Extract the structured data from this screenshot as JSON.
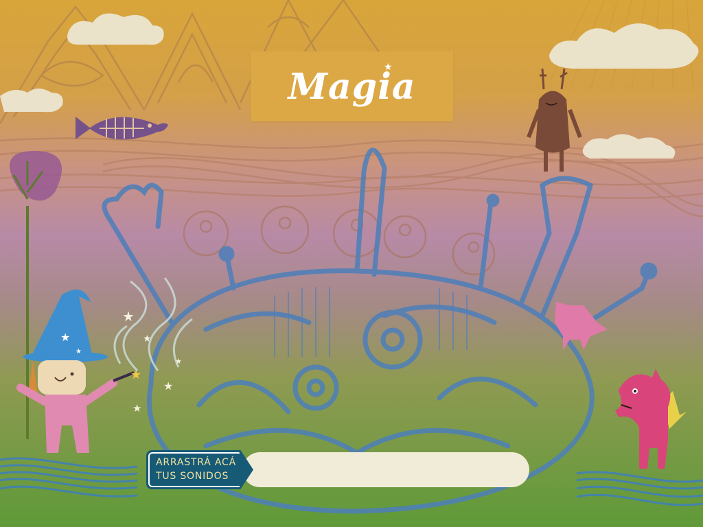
{
  "screen": {
    "title": "Magia",
    "drop_zone": {
      "label_line1": "ARRASTRÁ ACÁ",
      "label_line2": "TUS SONIDOS"
    }
  },
  "colors": {
    "sky_top": "#d9a63c",
    "sky_mid": "#c98f8a",
    "sky_pink": "#b98bb0",
    "ground_green": "#6aa03c",
    "title_plate": "#dca845",
    "drop_tag": "#165a76",
    "drop_bar": "#f1ecd8",
    "creature_blue": "#4f7fb8"
  },
  "icons": [
    "fish-icon",
    "star-icon",
    "cloud-icon",
    "tree-icon"
  ]
}
